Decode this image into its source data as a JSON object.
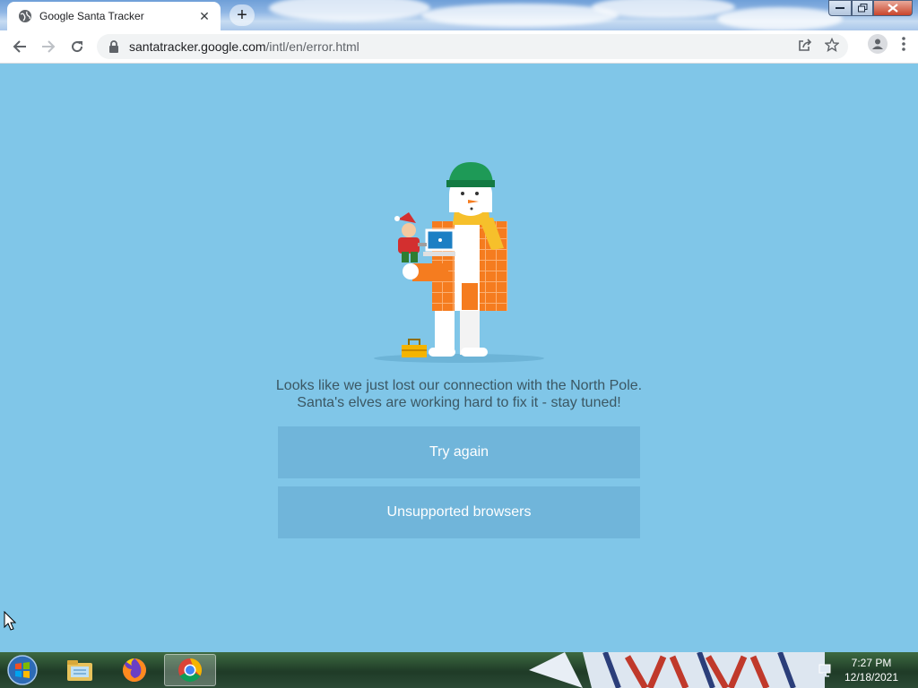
{
  "browser": {
    "tab": {
      "title": "Google Santa Tracker",
      "favicon": "globe-icon",
      "close": "✕"
    },
    "new_tab": "+",
    "address": {
      "domain": "santatracker.google.com",
      "path": "/intl/en/error.html"
    }
  },
  "page": {
    "message_line1": "Looks like we just lost our connection with the North Pole.",
    "message_line2": "Santa's elves are working hard to fix it - stay tuned!",
    "buttons": {
      "try_again": "Try again",
      "unsupported": "Unsupported browsers"
    },
    "background_color": "#80c6e8",
    "button_color": "#70b5da"
  },
  "taskbar": {
    "apps": [
      "file-explorer-icon",
      "firefox-icon",
      "chrome-icon"
    ],
    "clock": {
      "time": "7:27 PM",
      "date": "12/18/2021"
    }
  }
}
